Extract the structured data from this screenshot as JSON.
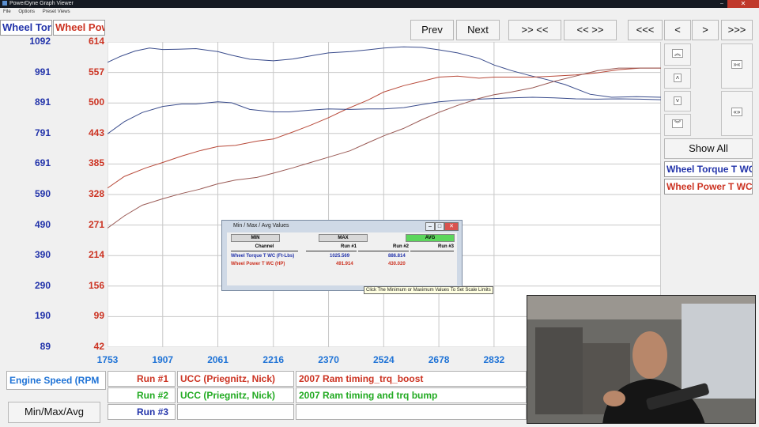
{
  "window": {
    "title": "PowerDyne Graph Viewer"
  },
  "menu": [
    "File",
    "Options",
    "Preset Views"
  ],
  "toolbar": {
    "prev": "Prev",
    "next": "Next",
    "zoom_in": ">> <<",
    "zoom_out": "<< >>",
    "far_left": "<<<",
    "left": "<",
    "right": ">",
    "far_right": ">>>"
  },
  "side": {
    "show_all": "Show All"
  },
  "headers": {
    "torque": "Wheel Torque T WC",
    "power": "Wheel Power T WC"
  },
  "colors": {
    "torque": "#2233aa",
    "power": "#cc3322",
    "xaxis": "#1f73d6",
    "run2": "#22aa22"
  },
  "chart_data": {
    "type": "line",
    "xlabel": "Engine Speed (RPM",
    "x_ticks": [
      1753,
      1907,
      2061,
      2216,
      2370,
      2524,
      2678,
      2832
    ],
    "xlim": [
      1753,
      3298
    ],
    "y_left": {
      "label": "Wheel Torque T WC",
      "ticks": [
        1092,
        991,
        891,
        791,
        691,
        590,
        490,
        390,
        290,
        190,
        89
      ],
      "ylim": [
        89,
        1092
      ]
    },
    "y_right": {
      "label": "Wheel Power T WC",
      "ticks": [
        614,
        557,
        500,
        443,
        385,
        328,
        271,
        214,
        156,
        99,
        42
      ],
      "ylim": [
        42,
        614
      ]
    },
    "series": [
      {
        "name": "Run #1 Wheel Torque T WC",
        "axis": "left",
        "color": "#3a4c8c",
        "x": [
          1753,
          1790,
          1830,
          1870,
          1907,
          1950,
          2000,
          2061,
          2100,
          2150,
          2216,
          2270,
          2330,
          2370,
          2430,
          2480,
          2524,
          2580,
          2630,
          2678,
          2730,
          2790,
          2832,
          2880,
          2930,
          2980,
          3030,
          3100,
          3160,
          3230,
          3298
        ],
        "y": [
          1025,
          1045,
          1062,
          1072,
          1067,
          1068,
          1070,
          1060,
          1048,
          1035,
          1030,
          1036,
          1048,
          1056,
          1060,
          1066,
          1072,
          1076,
          1074,
          1066,
          1056,
          1038,
          1016,
          998,
          982,
          968,
          952,
          920,
          910,
          912,
          910
        ]
      },
      {
        "name": "Run #1 Wheel Power T WC",
        "axis": "right",
        "color": "#b84a3a",
        "x": [
          1753,
          1800,
          1860,
          1907,
          1960,
          2010,
          2061,
          2110,
          2170,
          2216,
          2270,
          2320,
          2370,
          2420,
          2480,
          2524,
          2580,
          2630,
          2678,
          2730,
          2790,
          2832,
          2880,
          2940,
          3000,
          3060,
          3120,
          3180,
          3240,
          3298
        ],
        "y": [
          340,
          362,
          378,
          388,
          400,
          410,
          418,
          420,
          428,
          432,
          445,
          458,
          472,
          488,
          505,
          520,
          532,
          540,
          548,
          550,
          546,
          548,
          548,
          548,
          550,
          552,
          556,
          562,
          565,
          565
        ]
      },
      {
        "name": "Run #2 Wheel Torque T WC",
        "axis": "left",
        "color": "#3a4c8c",
        "x": [
          1753,
          1800,
          1850,
          1907,
          1960,
          2000,
          2061,
          2100,
          2150,
          2216,
          2260,
          2320,
          2370,
          2430,
          2480,
          2524,
          2580,
          2630,
          2678,
          2730,
          2790,
          2832,
          2880,
          2940,
          3000,
          3060,
          3120,
          3180,
          3240,
          3298
        ],
        "y": [
          790,
          830,
          860,
          880,
          888,
          888,
          895,
          892,
          870,
          862,
          862,
          868,
          872,
          870,
          872,
          872,
          876,
          886,
          895,
          900,
          904,
          906,
          908,
          910,
          908,
          905,
          904,
          905,
          904,
          902
        ]
      },
      {
        "name": "Run #2 Wheel Power T WC",
        "axis": "right",
        "color": "#9a5a55",
        "x": [
          1753,
          1800,
          1850,
          1907,
          1960,
          2010,
          2061,
          2110,
          2170,
          2216,
          2270,
          2320,
          2370,
          2430,
          2480,
          2524,
          2580,
          2630,
          2678,
          2730,
          2790,
          2832,
          2880,
          2940,
          3000,
          3060,
          3120,
          3180,
          3240,
          3298
        ],
        "y": [
          265,
          288,
          308,
          320,
          330,
          338,
          348,
          355,
          360,
          368,
          378,
          388,
          398,
          410,
          425,
          438,
          452,
          468,
          482,
          495,
          508,
          515,
          520,
          528,
          540,
          550,
          560,
          565,
          565,
          565
        ]
      }
    ]
  },
  "runs": [
    {
      "label": "Run #1",
      "color": "#cc3322",
      "customer": "UCC (Priegnitz, Nick)",
      "title": "2007 Ram timing_trq_boost"
    },
    {
      "label": "Run #2",
      "color": "#22aa22",
      "customer": "UCC (Priegnitz, Nick)",
      "title": "2007 Ram timing and trq bump"
    },
    {
      "label": "Run #3",
      "color": "#2233aa",
      "customer": "",
      "title": ""
    }
  ],
  "minmax_button": "Min/Max/Avg",
  "dialog": {
    "title": "Min / Max / Avg Values",
    "buttons": {
      "min": "MIN",
      "max": "MAX",
      "avg": "AVG"
    },
    "columns": [
      "Channel",
      "Run #1",
      "Run #2",
      "Run #3"
    ],
    "rows": [
      {
        "channel": "Wheel Torque T WC (Ft-Lbs)",
        "run1": "1025.569",
        "run2": "886.814",
        "run3": "",
        "color": "#2233aa"
      },
      {
        "channel": "Wheel Power T WC (HP)",
        "run1": "491.914",
        "run2": "430.020",
        "run3": "",
        "color": "#cc3322"
      }
    ],
    "tooltip": "Click The Minimum or Maximum Values To Set Scale Limits"
  }
}
